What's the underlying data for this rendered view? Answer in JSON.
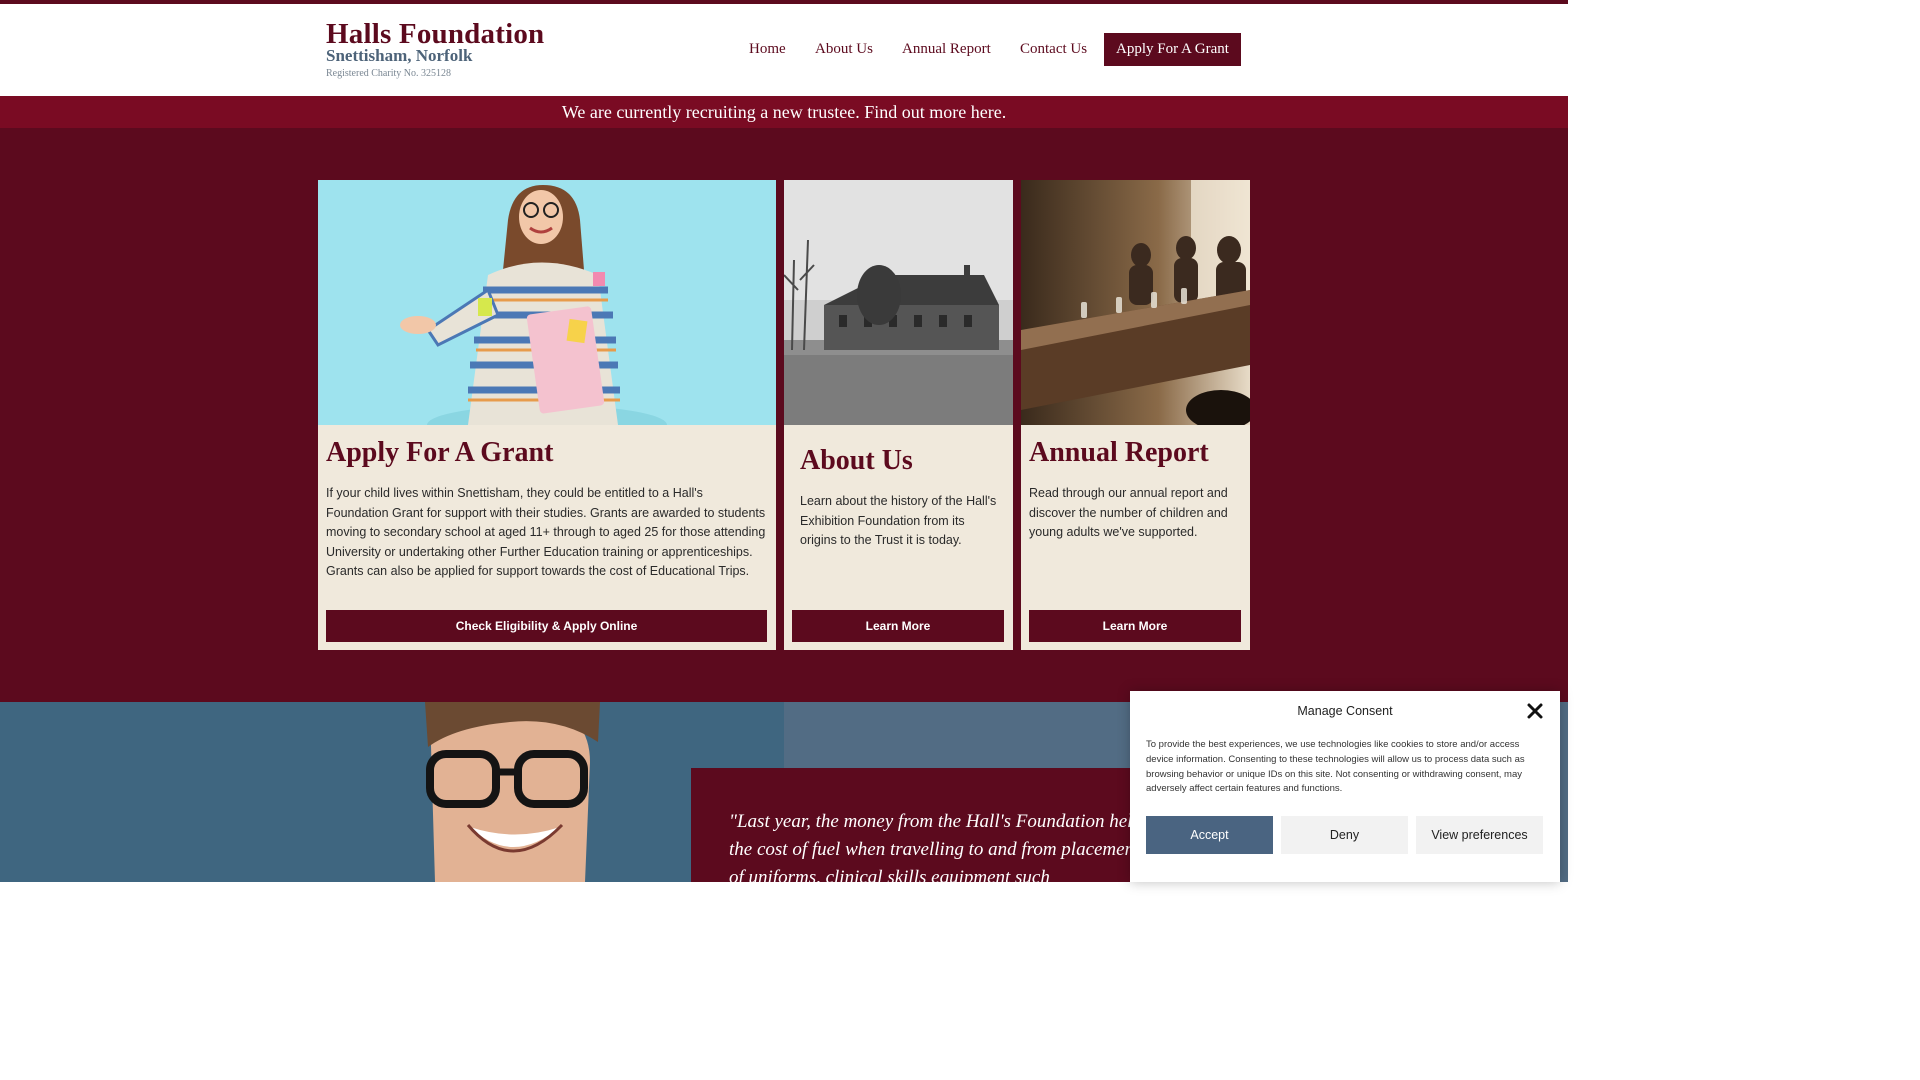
{
  "header": {
    "brand_title": "Halls Foundation",
    "brand_subtitle": "Snettisham, Norfolk",
    "charity_number": "Registered Charity No. 325128"
  },
  "nav": {
    "items": [
      {
        "label": "Home"
      },
      {
        "label": "About Us"
      },
      {
        "label": "Annual Report"
      },
      {
        "label": "Contact Us"
      }
    ],
    "cta_label": "Apply For A Grant"
  },
  "banner": {
    "text": "We are currently recruiting a new trustee. Find out more here."
  },
  "cards": [
    {
      "image": "student-girl-photo",
      "title": "Apply For A Grant",
      "text": "If your child lives within Snettisham, they could be entitled to a Hall's Foundation Grant for support with their studies. Grants are awarded to students moving to secondary school at aged 11+ through to aged 25 for those attending University or undertaking other Further Education training or apprenticeships. Grants can also be applied for support towards the cost of Educational Trips.",
      "button": "Check Eligibility & Apply Online"
    },
    {
      "image": "historic-building-photo",
      "title": "About Us",
      "text": "Learn about the history of the Hall's Exhibition Foundation from its origins to the Trust it is today.",
      "button": "Learn More"
    },
    {
      "image": "boardroom-meeting-photo",
      "title": "Annual Report",
      "text": "Read through our annual report and discover the number of children and young adults we've supported.",
      "button": "Learn More"
    }
  ],
  "testimonial": {
    "image": "smiling-student-photo",
    "quote": "\"Last year, the money from the Hall's Foundation helped towards the cost of fuel when travelling to and from placements, the cost of uniforms, clinical skills equipment such"
  },
  "consent": {
    "title": "Manage Consent",
    "text": "To provide the best experiences, we use technologies like cookies to store and/or access device information. Consenting to these technologies will allow us to process data such as browsing behavior or unique IDs on this site. Not consenting or withdrawing consent, may adversely affect certain features and functions.",
    "accept_label": "Accept",
    "deny_label": "Deny",
    "prefs_label": "View preferences"
  },
  "colors": {
    "brand": "#5c0a1e",
    "banner": "#7a0b23",
    "card_bg": "#f0e9dc",
    "slate": "#4d6379",
    "accept": "#4a6481"
  }
}
